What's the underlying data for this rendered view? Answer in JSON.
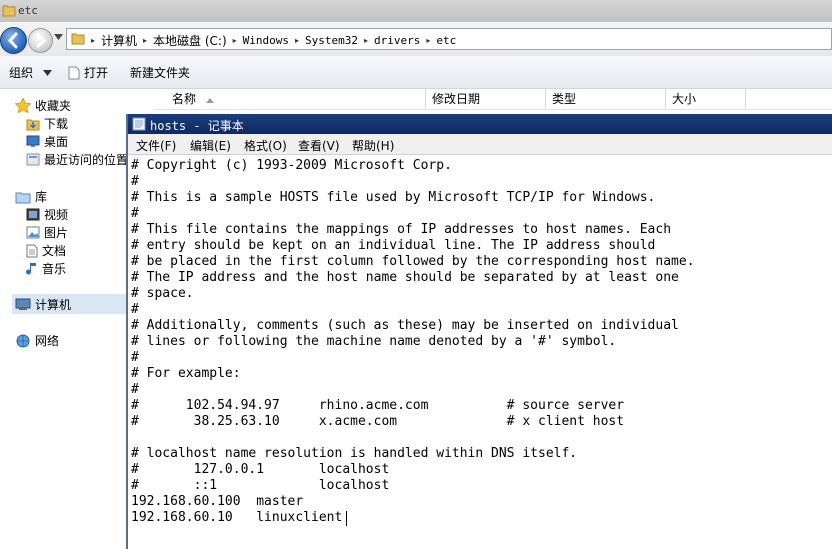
{
  "explorer": {
    "title": "etc",
    "breadcrumbs": [
      "计算机",
      "本地磁盘 (C:)",
      "Windows",
      "System32",
      "drivers",
      "etc"
    ],
    "toolbar": {
      "organize": "组织",
      "open": "打开",
      "new_folder": "新建文件夹"
    },
    "nav": {
      "favorites": "收藏夹",
      "downloads": "下载",
      "desktop": "桌面",
      "recent": "最近访问的位置",
      "libraries": "库",
      "videos": "视频",
      "pictures": "图片",
      "documents": "文档",
      "music": "音乐",
      "computer": "计算机",
      "network": "网络"
    },
    "columns": [
      "名称",
      "修改日期",
      "类型",
      "大小"
    ]
  },
  "notepad": {
    "title": "hosts - 记事本",
    "menu": [
      "文件(F)",
      "编辑(E)",
      "格式(O)",
      "查看(V)",
      "帮助(H)"
    ],
    "content": "# Copyright (c) 1993-2009 Microsoft Corp.\n#\n# This is a sample HOSTS file used by Microsoft TCP/IP for Windows.\n#\n# This file contains the mappings of IP addresses to host names. Each\n# entry should be kept on an individual line. The IP address should\n# be placed in the first column followed by the corresponding host name.\n# The IP address and the host name should be separated by at least one\n# space.\n#\n# Additionally, comments (such as these) may be inserted on individual\n# lines or following the machine name denoted by a '#' symbol.\n#\n# For example:\n#\n#      102.54.94.97     rhino.acme.com          # source server\n#       38.25.63.10     x.acme.com              # x client host\n\n# localhost name resolution is handled within DNS itself.\n#       127.0.0.1       localhost\n#       ::1             localhost\n192.168.60.100  master\n192.168.60.10   linuxclient"
  },
  "colors": {
    "notepad_title_bg": "#0d2a62",
    "nav_selection": "#d9e6f4"
  }
}
